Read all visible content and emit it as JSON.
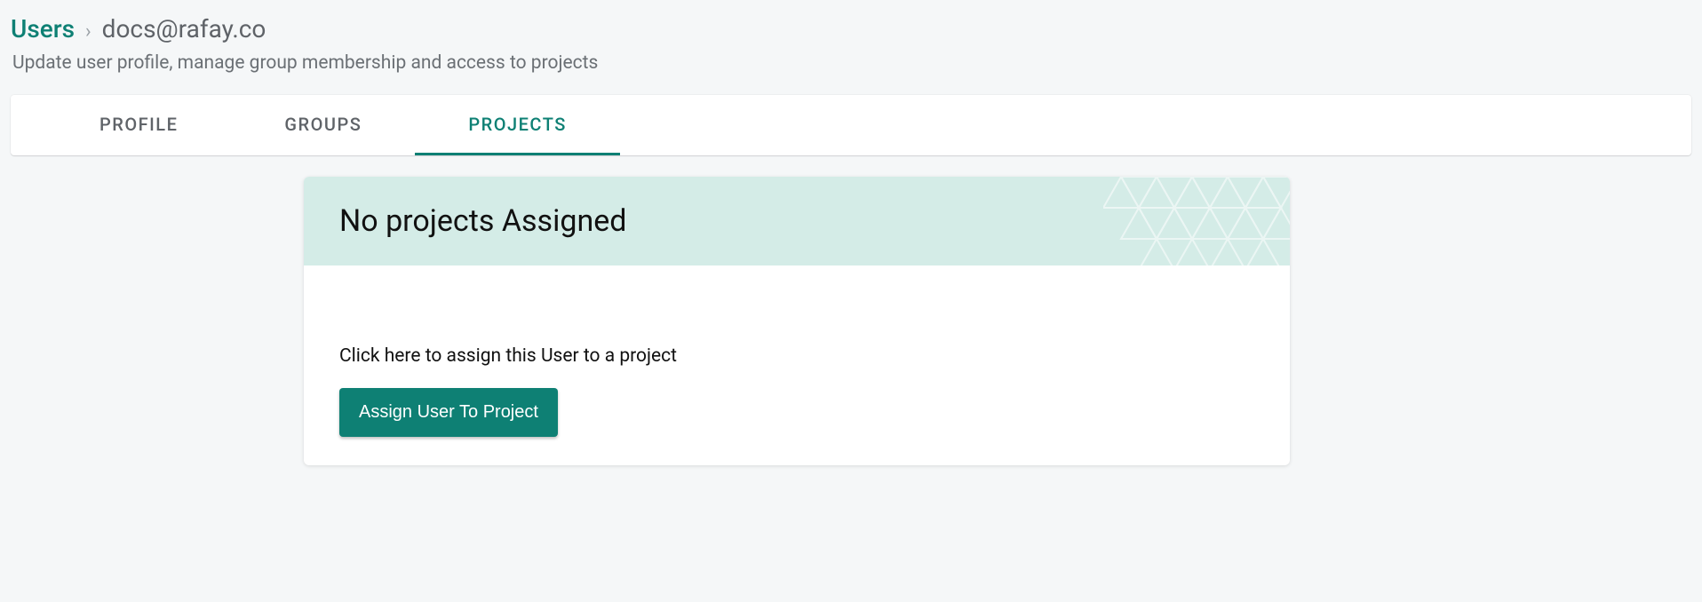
{
  "breadcrumb": {
    "root": "Users",
    "separator": "›",
    "current": "docs@rafay.co"
  },
  "subtitle": "Update user profile, manage group membership and access to projects",
  "tabs": [
    {
      "label": "PROFILE",
      "active": false
    },
    {
      "label": "GROUPS",
      "active": false
    },
    {
      "label": "PROJECTS",
      "active": true
    }
  ],
  "projects_card": {
    "header_title": "No projects Assigned",
    "body_text": "Click here to assign this User to a project",
    "button_label": "Assign User To Project"
  },
  "colors": {
    "accent": "#0e8074",
    "header_bg": "#d4ece7"
  }
}
